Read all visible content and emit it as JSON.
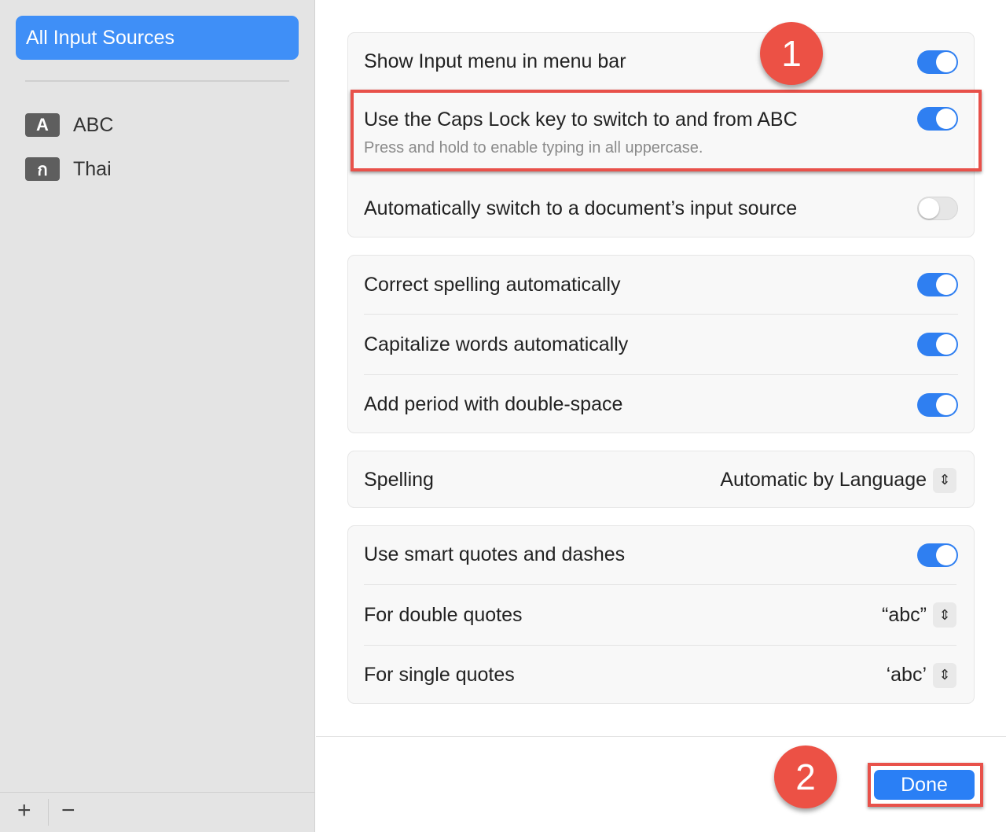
{
  "sidebar": {
    "selected": "All Input Sources",
    "sources": [
      {
        "badge": "A",
        "label": "ABC"
      },
      {
        "badge": "ก",
        "label": "Thai"
      }
    ],
    "add": "+",
    "remove": "−"
  },
  "groups": {
    "g1": [
      {
        "label": "Show Input menu in menu bar",
        "on": true
      },
      {
        "label": "Use the Caps Lock key to switch to and from ABC",
        "sub": "Press and hold to enable typing in all uppercase.",
        "on": true
      },
      {
        "label": "Automatically switch to a document’s input source",
        "on": false
      }
    ],
    "g2": [
      {
        "label": "Correct spelling automatically",
        "on": true
      },
      {
        "label": "Capitalize words automatically",
        "on": true
      },
      {
        "label": "Add period with double-space",
        "on": true
      }
    ],
    "g3": {
      "label": "Spelling",
      "value": "Automatic by Language"
    },
    "g4": [
      {
        "label": "Use smart quotes and dashes",
        "on": true
      },
      {
        "label": "For double quotes",
        "value": "“abc”"
      },
      {
        "label": "For single quotes",
        "value": "‘abc’"
      }
    ]
  },
  "done": "Done",
  "annotations": [
    "1",
    "2"
  ],
  "colors": {
    "accent": "#2f7ff1",
    "annotation": "#ec5145"
  }
}
